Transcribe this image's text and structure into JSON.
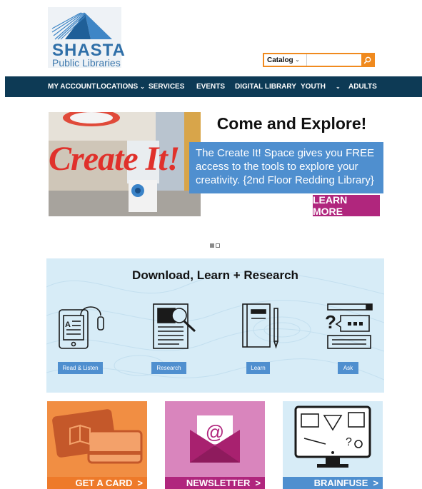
{
  "header": {
    "logo_name": "SHASTA",
    "logo_sub": "Public Libraries",
    "search": {
      "scope": "Catalog",
      "placeholder": ""
    }
  },
  "nav": {
    "items": [
      {
        "label": "MY ACCOUNT"
      },
      {
        "label": "LOCATIONS"
      },
      {
        "label": "SERVICES"
      },
      {
        "label": "EVENTS"
      },
      {
        "label": "DIGITAL LIBRARY"
      },
      {
        "label": "YOUTH"
      },
      {
        "label": "ADULTS"
      }
    ]
  },
  "hero": {
    "sign_text": "Create It!",
    "title": "Come and Explore!",
    "blurb": "The Create It! Space gives you FREE access to the tools to explore your creativity. {2nd Floor Redding Library}",
    "button": "LEARN MORE",
    "slides_total": 2,
    "slide_active": 1
  },
  "research": {
    "title": "Download, Learn + Research",
    "tiles": [
      {
        "label": "Read & Listen",
        "icon": "ereader-headphones-icon"
      },
      {
        "label": "Research",
        "icon": "document-magnifier-icon"
      },
      {
        "label": "Learn",
        "icon": "notebook-pen-icon"
      },
      {
        "label": "Ask",
        "icon": "question-chat-icon"
      }
    ]
  },
  "cards": [
    {
      "label": "GET A CARD",
      "color": "#f18e43",
      "icon": "library-card-icon"
    },
    {
      "label": "NEWSLETTER",
      "color": "#d985bd",
      "icon": "envelope-at-icon"
    },
    {
      "label": "BRAINFUSE",
      "color": "#d7ecf7",
      "icon": "monitor-tutoring-icon"
    }
  ],
  "colors": {
    "nav_bg": "#0d3a55",
    "accent_orange": "#f08a1e",
    "blue": "#4f8fcf",
    "magenta": "#b0267d"
  },
  "icons": {
    "search": "search-icon",
    "chevron": "chevron-down-icon"
  }
}
